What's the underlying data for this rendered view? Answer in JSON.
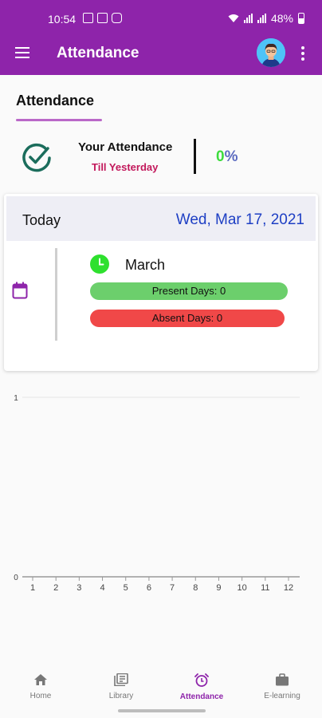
{
  "status_bar": {
    "time": "10:54",
    "battery": "48%"
  },
  "app_bar": {
    "title": "Attendance"
  },
  "section": {
    "title": "Attendance"
  },
  "summary": {
    "label": "Your Attendance",
    "sublabel": "Till Yesterday",
    "percent_value": "0",
    "percent_sign": "%"
  },
  "today_card": {
    "today_label": "Today",
    "date": "Wed, Mar 17, 2021",
    "month": "March",
    "present": "Present Days: 0",
    "absent": "Absent Days: 0"
  },
  "colors": {
    "primary": "#8e24aa",
    "present": "#6ccf6c",
    "absent": "#f04848",
    "date": "#1e3fc4",
    "sublabel": "#c2185b"
  },
  "chart_data": {
    "type": "line",
    "x": [
      1,
      2,
      3,
      4,
      5,
      6,
      7,
      8,
      9,
      10,
      11,
      12
    ],
    "ylim": [
      0,
      1
    ],
    "y_ticks": [
      "0",
      "1"
    ],
    "x_ticks": [
      "1",
      "2",
      "3",
      "4",
      "5",
      "6",
      "7",
      "8",
      "9",
      "10",
      "11",
      "12"
    ],
    "series": [],
    "grid": true
  },
  "bottom_nav": [
    {
      "label": "Home",
      "icon": "home-icon"
    },
    {
      "label": "Library",
      "icon": "library-icon"
    },
    {
      "label": "Attendance",
      "icon": "alarm-clock-icon"
    },
    {
      "label": "E-learning",
      "icon": "briefcase-icon"
    }
  ]
}
